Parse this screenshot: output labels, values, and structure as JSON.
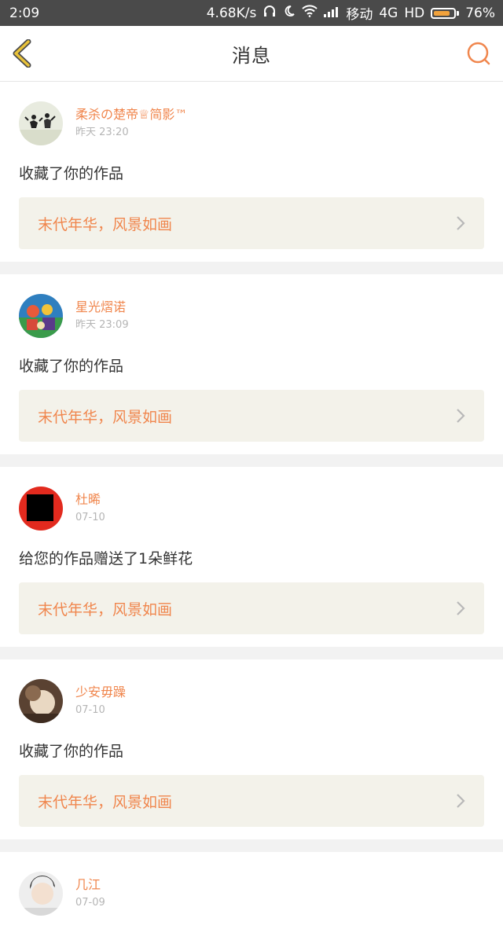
{
  "status": {
    "time": "2:09",
    "speed": "4.68K/s",
    "carrier": "移动",
    "network": "4G",
    "hd": "HD",
    "battery": "76%"
  },
  "header": {
    "title": "消息"
  },
  "messages": [
    {
      "user": "柔杀の楚帝♕简影™",
      "time": "昨天 23:20",
      "action": "收藏了你的作品",
      "work": "末代年华，风景如画"
    },
    {
      "user": "星光熠诺",
      "time": "昨天 23:09",
      "action": "收藏了你的作品",
      "work": "末代年华，风景如画"
    },
    {
      "user": "杜晞",
      "time": "07-10",
      "action": "给您的作品赠送了1朵鲜花",
      "work": "末代年华，风景如画"
    },
    {
      "user": "少安毋躁",
      "time": "07-10",
      "action": "收藏了你的作品",
      "work": "末代年华，风景如画"
    },
    {
      "user": "几江",
      "time": "07-09",
      "action": "",
      "work": ""
    }
  ],
  "colors": {
    "accent": "#f0864d",
    "back_arrow": "#e8c23a",
    "work_bg": "#f3f2ea"
  }
}
